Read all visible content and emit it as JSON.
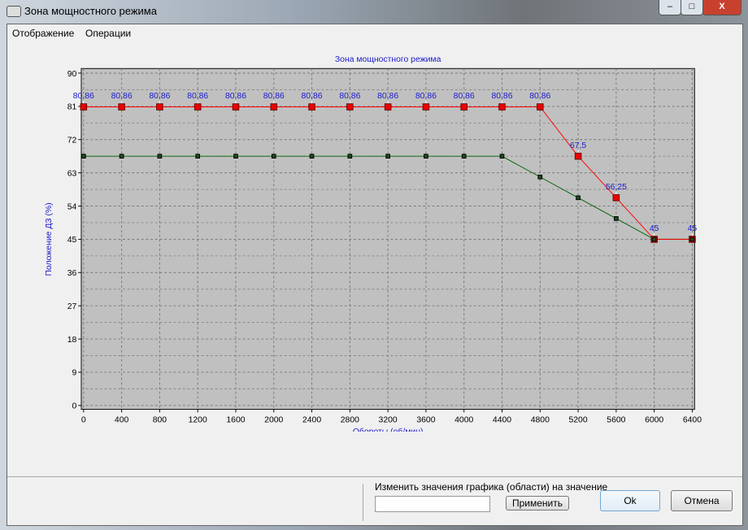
{
  "window": {
    "title": "Зона мощностного режима",
    "minimize": "–",
    "maximize": "□",
    "close": "X"
  },
  "menu": [
    "Отображение",
    "Операции"
  ],
  "bottom": {
    "label": "Изменить значения графика (области) на значение",
    "input_value": "",
    "apply": "Применить",
    "ok": "Ok",
    "cancel": "Отмена"
  },
  "chart_data": {
    "type": "line",
    "title": "Зона мощностного режима",
    "xlabel": "Обороты (об/мин)",
    "ylabel": "Положение ДЗ (%)",
    "x": [
      0,
      400,
      800,
      1200,
      1600,
      2000,
      2400,
      2800,
      3200,
      3600,
      4000,
      4400,
      4800,
      5200,
      5600,
      6000,
      6400
    ],
    "xlim": [
      0,
      6400
    ],
    "ylim": [
      0,
      90
    ],
    "yticks": [
      0,
      9,
      18,
      27,
      36,
      45,
      54,
      63,
      72,
      81,
      90
    ],
    "grid": true,
    "series": [
      {
        "name": "red",
        "color": "#ff0000",
        "values": [
          80.86,
          80.86,
          80.86,
          80.86,
          80.86,
          80.86,
          80.86,
          80.86,
          80.86,
          80.86,
          80.86,
          80.86,
          80.86,
          67.5,
          56.25,
          45,
          45
        ],
        "labels": [
          "80,86",
          "80,86",
          "80,86",
          "80,86",
          "80,86",
          "80,86",
          "80,86",
          "80,86",
          "80,86",
          "80,86",
          "80,86",
          "80,86",
          "80,86",
          "67,5",
          "56,25",
          "45",
          "45"
        ]
      },
      {
        "name": "green",
        "color": "#006400",
        "values": [
          67.5,
          67.5,
          67.5,
          67.5,
          67.5,
          67.5,
          67.5,
          67.5,
          67.5,
          67.5,
          67.5,
          67.5,
          61.875,
          56.25,
          50.625,
          45,
          45
        ]
      }
    ]
  }
}
